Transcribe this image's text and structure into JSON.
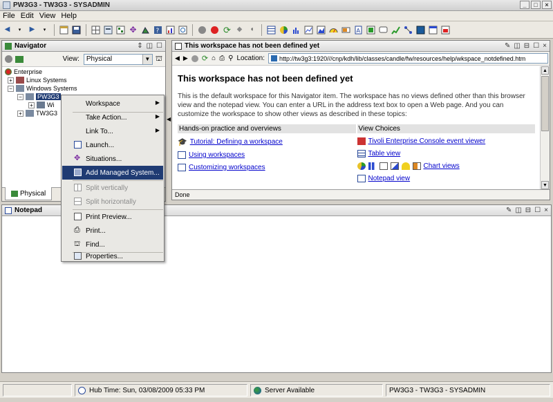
{
  "window": {
    "title": "PW3G3 - TW3G3 - SYSADMIN",
    "minimize": "_",
    "maximize": "□",
    "close": "×"
  },
  "menubar": [
    "File",
    "Edit",
    "View",
    "Help"
  ],
  "navigator": {
    "title": "Navigator",
    "view_label": "View:",
    "view_value": "Physical",
    "tree": [
      "Enterprise",
      "Linux Systems",
      "Windows Systems",
      "PW3G3",
      "Wi",
      "TW3G3"
    ],
    "tab": "Physical"
  },
  "workspace": {
    "panel_title": "This workspace has not been defined yet",
    "location_label": "Location:",
    "url": "http://tw3g3:1920///cnp/kdh/lib/classes/candle/fw/resources/help/wkspace_notdefined.htm",
    "heading": "This workspace has not been defined yet",
    "intro": "This is the default workspace for this Navigator item. The workspace has no views defined other than this browser view and the notepad view. You can enter a URL in the address text box to open a Web page. And you can customize the workspace to show other views as described in these topics:",
    "col1": {
      "header": "Hands-on practice and overviews",
      "links": [
        "Tutorial: Defining a workspace",
        "Using workspaces",
        "Customizing workspaces"
      ]
    },
    "col2": {
      "header": "View Choices",
      "links": [
        "Tivoli Enterprise Console event viewer",
        "Table view",
        "Chart views",
        "Notepad view"
      ]
    },
    "status": "Done"
  },
  "notepad": {
    "title": "Notepad"
  },
  "context_menu": [
    "Workspace",
    "Take Action...",
    "Link To...",
    "Launch...",
    "Situations...",
    "Add Managed System...",
    "Split vertically",
    "Split horizontally",
    "Print Preview...",
    "Print...",
    "Find...",
    "Properties..."
  ],
  "statusbar": {
    "hub_time": "Hub Time: Sun, 03/08/2009 05:33 PM",
    "server": "Server Available",
    "user": "PW3G3 - TW3G3 - SYSADMIN"
  },
  "colors": {
    "menu_highlight": "#1f3b73",
    "link": "#0000cc"
  }
}
